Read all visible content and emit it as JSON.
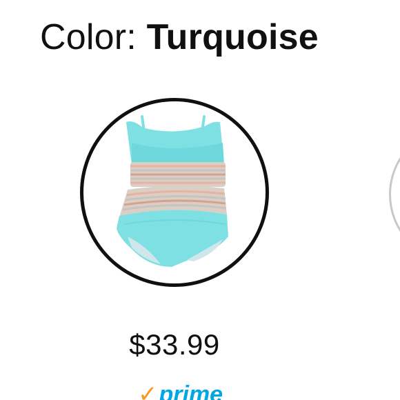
{
  "color_selector": {
    "label": "Color: ",
    "value": "Turquoise"
  },
  "selected_swatch": {
    "alt": "Turquoise two-piece swimsuit",
    "colors": {
      "fabric": "#7fe0e3",
      "fabric_shadow": "#5ccfd4",
      "lining": "#cfe6ea",
      "band_stripes": [
        "#e8b2a0",
        "#c9c3bd",
        "#d9a08f"
      ],
      "border": "#0f1111"
    }
  },
  "price": "$33.99",
  "prime": {
    "label": "prime",
    "check_icon": "prime-check-icon",
    "color": "#00a8e1",
    "check_color": "#f8991d"
  }
}
